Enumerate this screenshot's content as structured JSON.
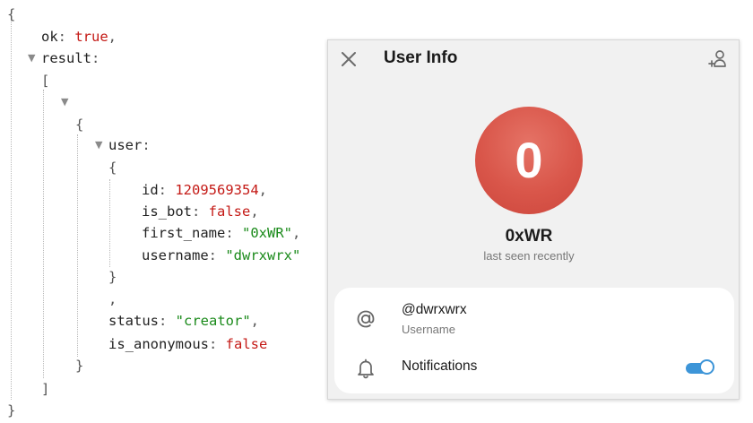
{
  "json_view": {
    "ok_key": "ok",
    "ok_val": "true",
    "result_key": "result",
    "user_key": "user",
    "id_key": "id",
    "id_val": "1209569354",
    "is_bot_key": "is_bot",
    "is_bot_val": "false",
    "first_name_key": "first_name",
    "first_name_val": "\"0xWR\"",
    "username_key": "username",
    "username_val": "\"dwrxwrx\"",
    "status_key": "status",
    "status_val": "\"creator\"",
    "is_anonymous_key": "is_anonymous",
    "is_anonymous_val": "false"
  },
  "user_info": {
    "title": "User Info",
    "avatar_letter": "0",
    "display_name": "0xWR",
    "last_seen": "last seen recently",
    "username": "@dwrxwrx",
    "username_label": "Username",
    "notifications_label": "Notifications",
    "notifications_on": true,
    "avatar_color": "#d9564a",
    "toggle_color": "#3d95d8"
  }
}
